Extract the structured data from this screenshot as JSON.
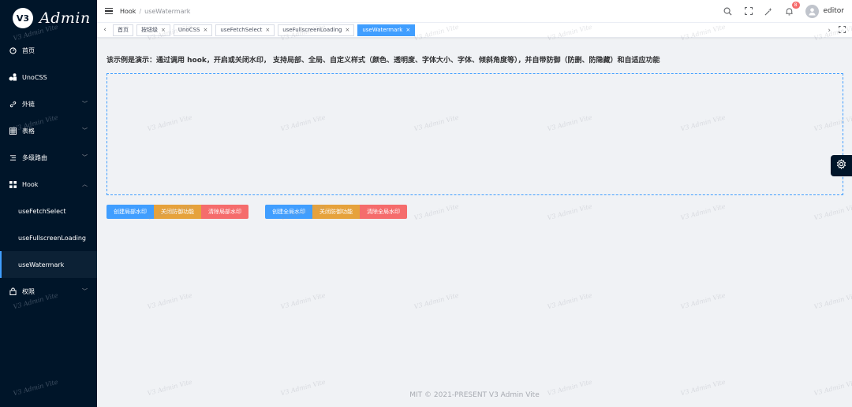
{
  "app": {
    "logo_text": "Admin",
    "logo_mark": "V3"
  },
  "sidebar": {
    "items": [
      {
        "label": "首页",
        "icon": "dashboard-icon"
      },
      {
        "label": "UnoCSS",
        "icon": "unocss-icon"
      },
      {
        "label": "外链",
        "icon": "link-icon"
      },
      {
        "label": "表格",
        "icon": "table-icon"
      },
      {
        "label": "多级路由",
        "icon": "menu-icon"
      },
      {
        "label": "Hook",
        "icon": "grid-icon"
      },
      {
        "label": "权限",
        "icon": "lock-icon"
      }
    ],
    "hook_children": [
      "useFetchSelect",
      "useFullscreenLoading",
      "useWatermark"
    ]
  },
  "header": {
    "breadcrumb": [
      "Hook",
      "useWatermark"
    ],
    "notification_count": "8",
    "username": "editor"
  },
  "tags": [
    {
      "label": "首页",
      "closable": false
    },
    {
      "label": "按钮级",
      "closable": true
    },
    {
      "label": "UnoCSS",
      "closable": true
    },
    {
      "label": "useFetchSelect",
      "closable": true
    },
    {
      "label": "useFullscreenLoading",
      "closable": true
    },
    {
      "label": "useWatermark",
      "closable": true,
      "active": true
    }
  ],
  "main": {
    "description": "该示例是演示：通过调用 hook，开启或关闭水印， 支持局部、全局、自定义样式（颜色、透明度、字体大小、字体、倾斜角度等），并自带防御（防删、防隐藏）和自适应功能",
    "local_buttons": [
      "创建局部水印",
      "关闭防御功能",
      "清除局部水印"
    ],
    "global_buttons": [
      "创建全局水印",
      "关闭防御功能",
      "清除全局水印"
    ]
  },
  "footer": "MIT © 2021-PRESENT V3 Admin Vite",
  "watermark_text": "V3 Admin Vite",
  "colors": {
    "sidebar_bg": "#001529",
    "primary": "#409eff",
    "warning": "#e6a23c",
    "danger": "#f56c6c"
  }
}
